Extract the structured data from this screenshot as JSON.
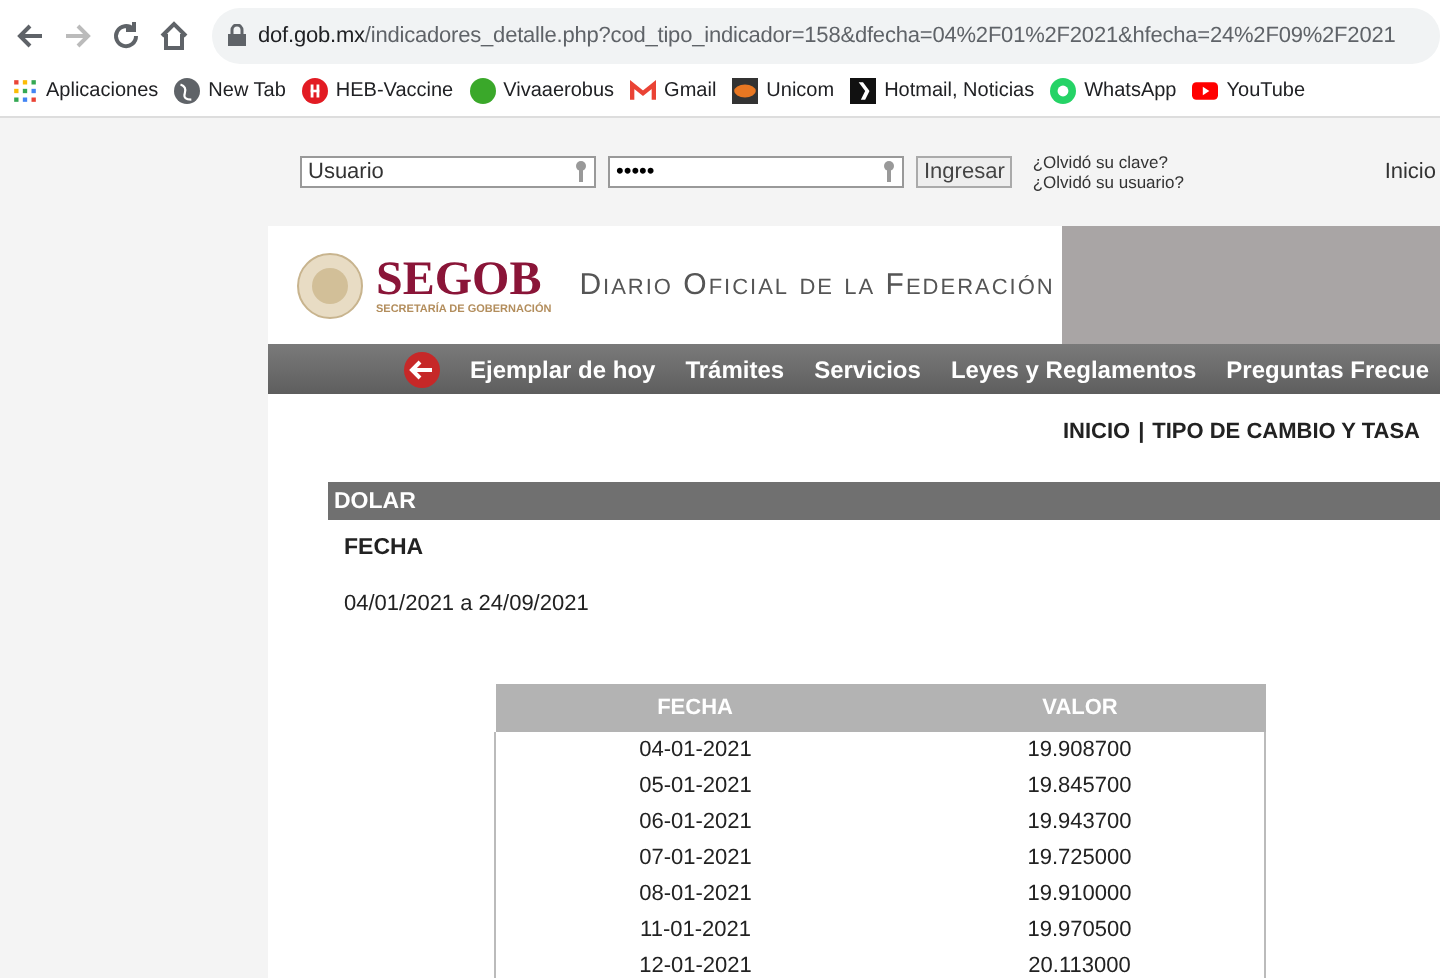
{
  "browser": {
    "url_host": "dof.gob.mx",
    "url_path": "/indicadores_detalle.php?cod_tipo_indicador=158&dfecha=04%2F01%2F2021&hfecha=24%2F09%2F2021",
    "bookmarks": [
      {
        "label": "Aplicaciones",
        "kind": "apps"
      },
      {
        "label": "New Tab",
        "kind": "globe"
      },
      {
        "label": "HEB-Vaccine",
        "kind": "red"
      },
      {
        "label": "Vivaaerobus",
        "kind": "green"
      },
      {
        "label": "Gmail",
        "kind": "mail"
      },
      {
        "label": "Unicom",
        "kind": "dark"
      },
      {
        "label": "Hotmail, Noticias",
        "kind": "black"
      },
      {
        "label": "WhatsApp",
        "kind": "whatsapp"
      },
      {
        "label": "YouTube",
        "kind": "youtube"
      }
    ]
  },
  "login": {
    "user_placeholder": "Usuario",
    "password_value": "•••••",
    "submit": "Ingresar",
    "links": [
      "¿Olvidó su clave?",
      "¿Olvidó su usuario?"
    ],
    "top_link": "Inicio"
  },
  "header": {
    "logo": "SEGOB",
    "logo_subtitle": "SECRETARÍA DE GOBERNACIÓN",
    "site_title": "Diario Oficial de la Federación"
  },
  "nav": [
    "Ejemplar de hoy",
    "Trámites",
    "Servicios",
    "Leyes y Reglamentos",
    "Preguntas Frecue"
  ],
  "breadcrumb": {
    "items": [
      "INICIO",
      "TIPO DE CAMBIO Y TASA"
    ],
    "separator": "|"
  },
  "section": {
    "title": "DOLAR",
    "label": "FECHA",
    "range": "04/01/2021 a 24/09/2021"
  },
  "table": {
    "columns": [
      "FECHA",
      "VALOR"
    ],
    "rows": [
      [
        "04-01-2021",
        "19.908700"
      ],
      [
        "05-01-2021",
        "19.845700"
      ],
      [
        "06-01-2021",
        "19.943700"
      ],
      [
        "07-01-2021",
        "19.725000"
      ],
      [
        "08-01-2021",
        "19.910000"
      ],
      [
        "11-01-2021",
        "19.970500"
      ],
      [
        "12-01-2021",
        "20.113000"
      ]
    ]
  }
}
